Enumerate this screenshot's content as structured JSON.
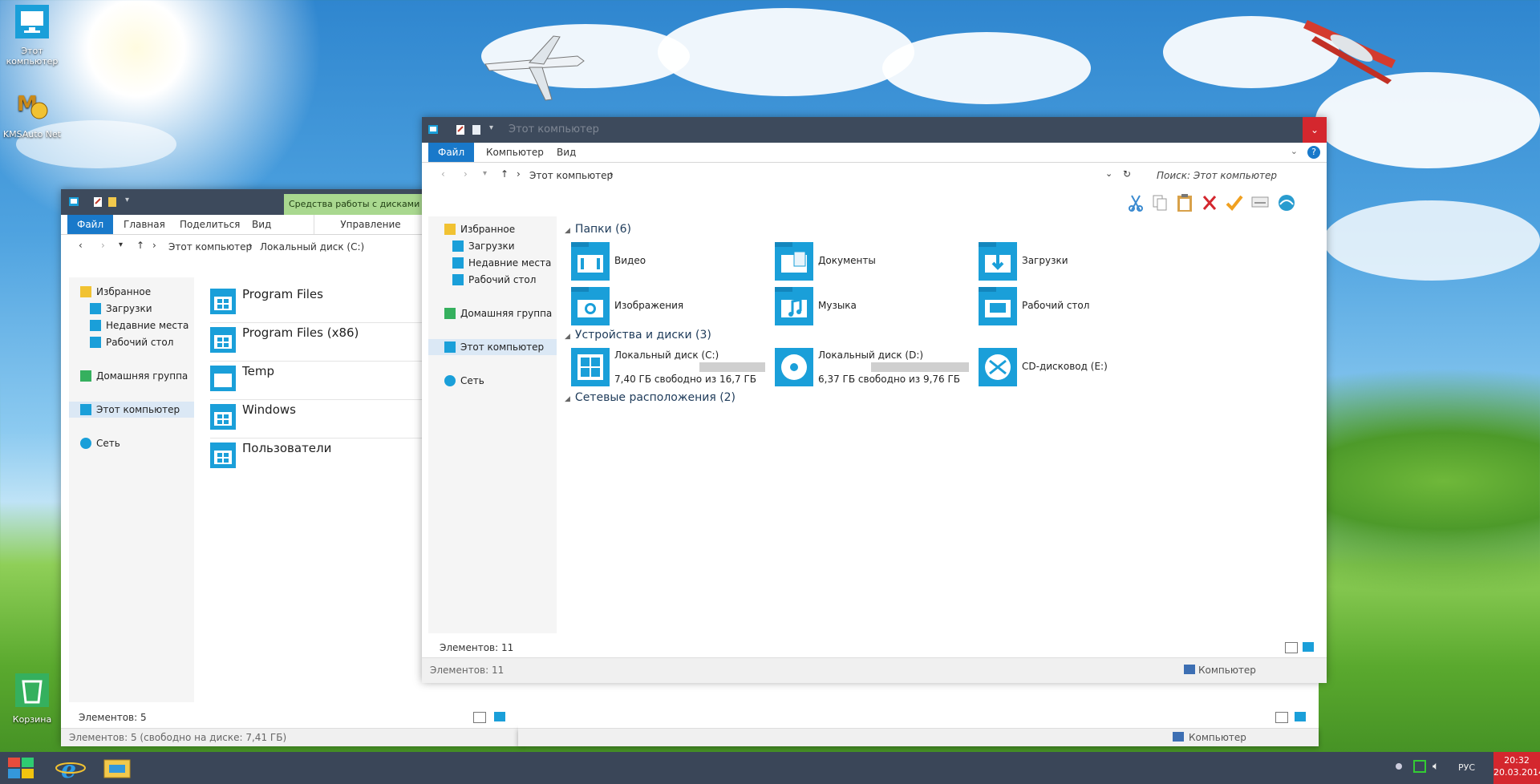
{
  "desktop": {
    "icons": [
      {
        "label": "Этот компьютер",
        "icon": "computer-icon"
      },
      {
        "label": "KMSAuto Net",
        "icon": "kmsauto-icon"
      },
      {
        "label": "Корзина",
        "icon": "recycle-bin-icon"
      }
    ]
  },
  "window_front": {
    "title": "Этот компьютер",
    "tabs": [
      "Файл",
      "Компьютер",
      "Вид"
    ],
    "address": {
      "path": "Этот компьютер",
      "search_placeholder": "Поиск: Этот компьютер"
    },
    "nav": {
      "favorites": "Избранное",
      "downloads": "Загрузки",
      "recent": "Недавние места",
      "desktop": "Рабочий стол",
      "homegroup": "Домашняя группа",
      "this_pc": "Этот компьютер",
      "network": "Сеть"
    },
    "groups": {
      "folders": "Папки (6)",
      "devices": "Устройства и диски (3)",
      "network": "Сетевые расположения (2)"
    },
    "folders": [
      "Видео",
      "Документы",
      "Загрузки",
      "Изображения",
      "Музыка",
      "Рабочий стол"
    ],
    "drives": [
      {
        "name": "Локальный диск (C:)",
        "free": "7,40 ГБ свободно из 16,7 ГБ",
        "used_fraction": 0.56
      },
      {
        "name": "Локальный диск (D:)",
        "free": "6,37 ГБ свободно из 9,76 ГБ",
        "used_fraction": 0.35
      },
      {
        "name": "CD-дисковод (E:)",
        "free": ""
      }
    ],
    "status_items": "Элементов: 11",
    "status_items2": "Элементов: 11",
    "status_computer": "Компьютер"
  },
  "window_back": {
    "tabs": [
      "Файл",
      "Главная",
      "Поделиться",
      "Вид"
    ],
    "contextual_tab_group": "Средства работы с дисками",
    "contextual_tab": "Управление",
    "address": {
      "path1": "Этот компьютер",
      "path2": "Локальный диск (C:)"
    },
    "nav": {
      "favorites": "Избранное",
      "downloads": "Загрузки",
      "recent": "Недавние места",
      "desktop": "Рабочий стол",
      "homegroup": "Домашняя группа",
      "this_pc": "Этот компьютер",
      "network": "Сеть"
    },
    "files": [
      "Program Files",
      "Program Files (x86)",
      "Temp",
      "Windows",
      "Пользователи"
    ],
    "status_items": "Элементов: 5",
    "status_full": "Элементов: 5 (свободно на диске: 7,41 ГБ)",
    "status_computer": "Компьютер"
  },
  "taskbar": {
    "language": "РУС",
    "time": "20:32",
    "date": "20.03.2014"
  },
  "colors": {
    "accent": "#1979ca",
    "tile": "#1a9fd9",
    "titlebar": "#3d4a5c",
    "close": "#d4272e",
    "contextual": "#a9d88f"
  }
}
